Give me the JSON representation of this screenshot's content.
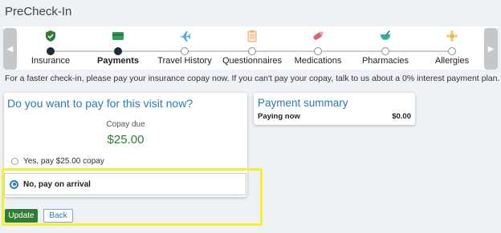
{
  "page": {
    "title": "PreCheck-In"
  },
  "stepper": {
    "steps": [
      {
        "label": "Insurance",
        "icon": "shield-icon",
        "color": "#2e7d32",
        "state": "completed"
      },
      {
        "label": "Payments",
        "icon": "credit-card-icon",
        "color": "#2e9e5a",
        "state": "current"
      },
      {
        "label": "Travel History",
        "icon": "airplane-icon",
        "color": "#4aa8e0",
        "state": "pending"
      },
      {
        "label": "Questionnaires",
        "icon": "clipboard-icon",
        "color": "#e8a86a",
        "state": "pending"
      },
      {
        "label": "Medications",
        "icon": "pill-icon",
        "color": "#e0607a",
        "state": "pending"
      },
      {
        "label": "Pharmacies",
        "icon": "mortar-icon",
        "color": "#2fb0a0",
        "state": "pending"
      },
      {
        "label": "Allergies",
        "icon": "pollen-icon",
        "color": "#e8b84a",
        "state": "pending"
      }
    ]
  },
  "info_text": "For a faster check-in, please pay your insurance copay now. If you can't pay your copay, talk to us about a 0% interest payment plan.",
  "payment_card": {
    "heading": "Do you want to pay for this visit now?",
    "copay_label": "Copay due",
    "copay_amount": "$25.00",
    "option_yes": "Yes, pay $25.00 copay",
    "option_no": "No, pay on arrival",
    "selected": "no"
  },
  "actions": {
    "update_label": "Update",
    "back_label": "Back"
  },
  "summary": {
    "heading": "Payment summary",
    "paying_now_label": "Paying now",
    "paying_now_value": "$0.00"
  },
  "colors": {
    "accent": "#2a7ab3",
    "success": "#2e7d32",
    "highlight": "#f3f032"
  }
}
